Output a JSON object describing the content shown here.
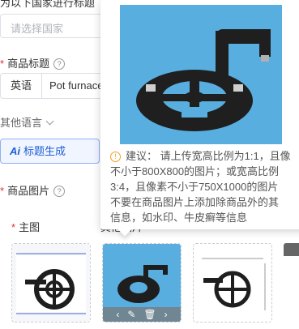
{
  "country": {
    "top_label": "为以下国家进行标题",
    "placeholder": "请选择国家"
  },
  "product_title": {
    "label": "商品标题",
    "help_icon": "question-circle-icon",
    "language": "英语",
    "value": "Pot furnace"
  },
  "other_languages": {
    "label": "其他语言",
    "icon": "chevron-down-icon"
  },
  "title_generate": {
    "ai_badge": "Ai",
    "label": "标题生成"
  },
  "product_images": {
    "label": "商品图片",
    "help_icon": "question-circle-icon",
    "main_label": "主图",
    "hidden_label": "其他图片",
    "thumb_actions": [
      "‹",
      "✎",
      "🗑",
      "›"
    ]
  },
  "tooltip": {
    "lines": [
      "建议：  请上传宽高比例为1:1，且像",
      "不小于800X800的图片；或宽高比例",
      "3:4，且像素不小于750X1000的图片",
      "不要在商品图片上添加除商品外的其",
      "信息，如水印、牛皮癣等信息"
    ],
    "icon": "warning-circle-icon"
  },
  "colors": {
    "required": "#e0303b",
    "accent": "#1d5fd6",
    "warning": "#f0a020",
    "photo_bg": "#59aee0"
  }
}
